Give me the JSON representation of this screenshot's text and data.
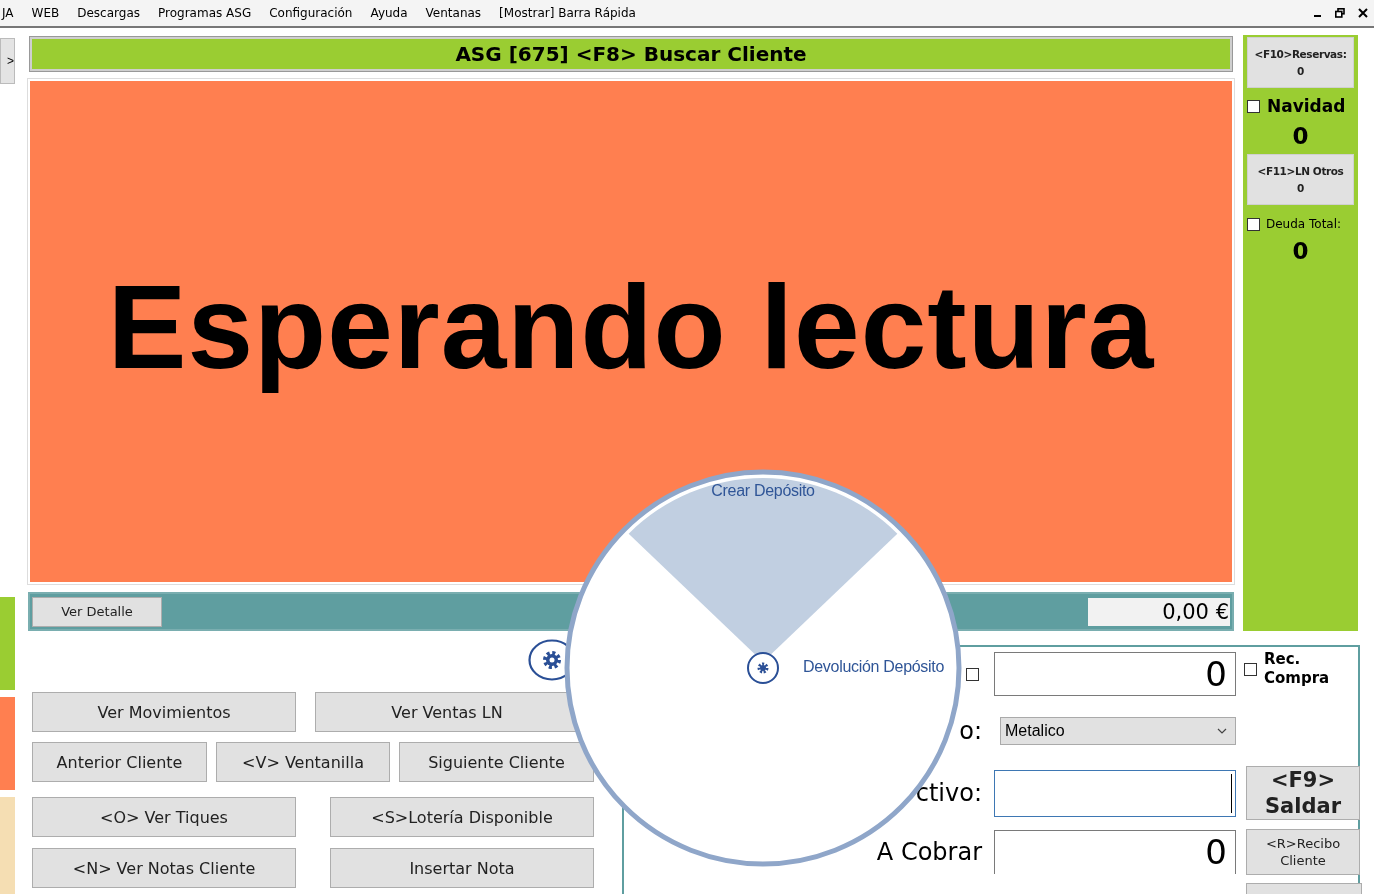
{
  "menu_bar": {
    "items": [
      "JA",
      "WEB",
      "Descargas",
      "Programas ASG",
      "Configuración",
      "Ayuda",
      "Ventanas",
      "[Mostrar] Barra Rápida"
    ]
  },
  "side_strip": {
    "button": ">",
    "swatches": [
      {
        "color": "#9acd32"
      },
      {
        "color": "#ff7f50"
      },
      {
        "color": "#f5deb3"
      }
    ]
  },
  "title": "ASG [675] <F8> Buscar Cliente",
  "status": {
    "message": "Esperando lectura"
  },
  "detail_bar": {
    "button": "Ver Detalle",
    "total": "0,00 €"
  },
  "right_panel": {
    "reservas": {
      "label": "<F10>Reservas:",
      "count": "0"
    },
    "navidad": {
      "label": "Navidad",
      "checked": false,
      "count": "0"
    },
    "otros": {
      "label": "<F11>LN Otros",
      "count": "0"
    },
    "deuda": {
      "label": "Deuda Total:",
      "checked": false,
      "value": "0"
    }
  },
  "action_rows": [
    [
      "Ver Movimientos",
      "Ver Ventas LN"
    ],
    [
      "Anterior Cliente",
      "<V> Ventanilla",
      "Siguiente Cliente"
    ],
    [
      "<O> Ver Tiques",
      "<S>Lotería Disponible"
    ],
    [
      "<N> Ver Notas Cliente",
      "Insertar Nota"
    ]
  ],
  "payment": {
    "amount": {
      "checked": false,
      "value": "0"
    },
    "rec_compra": {
      "label": "Rec. Compra",
      "checked": false
    },
    "method": {
      "label": "o:",
      "value": "Metalico"
    },
    "cash": {
      "label": "ctivo:"
    },
    "to_charge": {
      "label": "A Cobrar",
      "value": "0"
    },
    "saldar": "<F9> Saldar",
    "recibo": "<R>Recibo Cliente"
  },
  "radial_menu": {
    "items": [
      {
        "label": "Crear Depósito",
        "selected": true
      },
      {
        "label": "Devolución Depósito",
        "selected": false
      }
    ]
  }
}
